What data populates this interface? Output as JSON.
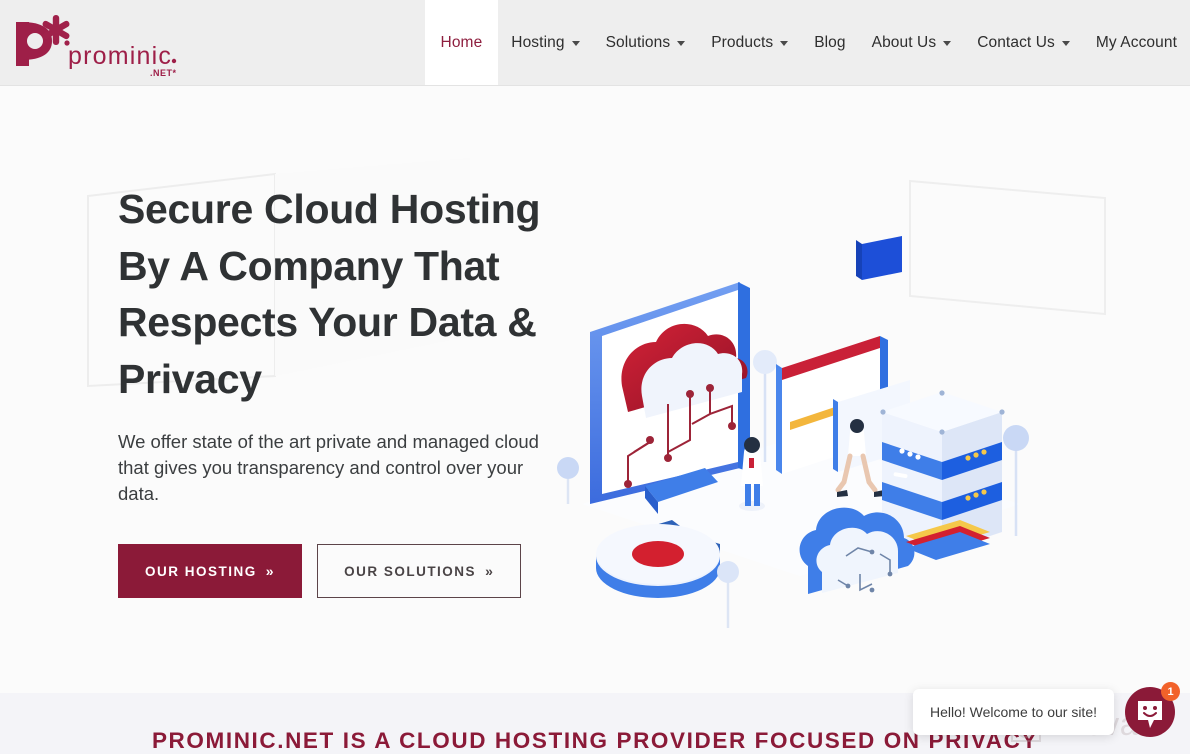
{
  "brand": {
    "logo_word": "prominic",
    "logo_suffix": ".NET*",
    "logo_mark": "p-asterisk-logo",
    "accent": "#8b1a38"
  },
  "header": {
    "background": "#eeeeee",
    "nav": [
      {
        "label": "Home",
        "name": "nav-item-home",
        "active": true,
        "caret": false
      },
      {
        "label": "Hosting",
        "name": "nav-item-hosting",
        "active": false,
        "caret": true
      },
      {
        "label": "Solutions",
        "name": "nav-item-solutions",
        "active": false,
        "caret": true
      },
      {
        "label": "Products",
        "name": "nav-item-products",
        "active": false,
        "caret": true
      },
      {
        "label": "Blog",
        "name": "nav-item-blog",
        "active": false,
        "caret": false
      },
      {
        "label": "About Us",
        "name": "nav-item-about-us",
        "active": false,
        "caret": true
      },
      {
        "label": "Contact Us",
        "name": "nav-item-contact-us",
        "active": false,
        "caret": true
      },
      {
        "label": "My Account",
        "name": "nav-item-my-account",
        "active": false,
        "caret": false
      }
    ]
  },
  "hero": {
    "title": "Secure Cloud Hosting By A Company That Respects Your Data & Privacy",
    "subtitle": "We offer state of the art private and managed cloud that gives you transparency and control over your data.",
    "buttons": [
      {
        "label": "OUR HOSTING",
        "chevron": "»",
        "style": "primary"
      },
      {
        "label": "OUR SOLUTIONS",
        "chevron": "»",
        "style": "secondary"
      }
    ],
    "illustration": "isometric-cloud-hosting-illustration",
    "background": "#fbfbfb"
  },
  "band": {
    "title": "PROMINIC.NET IS A CLOUD HOSTING PROVIDER FOCUSED ON PRIVACY",
    "background": "#f4f4f8",
    "color": "#8b1a38"
  },
  "chat": {
    "message": "Hello! Welcome to our site!",
    "badge_count": "1",
    "icon": "chat-smiley-icon",
    "badge_color": "#f2622a",
    "orb_color": "#8b1a38"
  },
  "watermark": {
    "text": "Revain",
    "icon": "image-frame-icon"
  }
}
